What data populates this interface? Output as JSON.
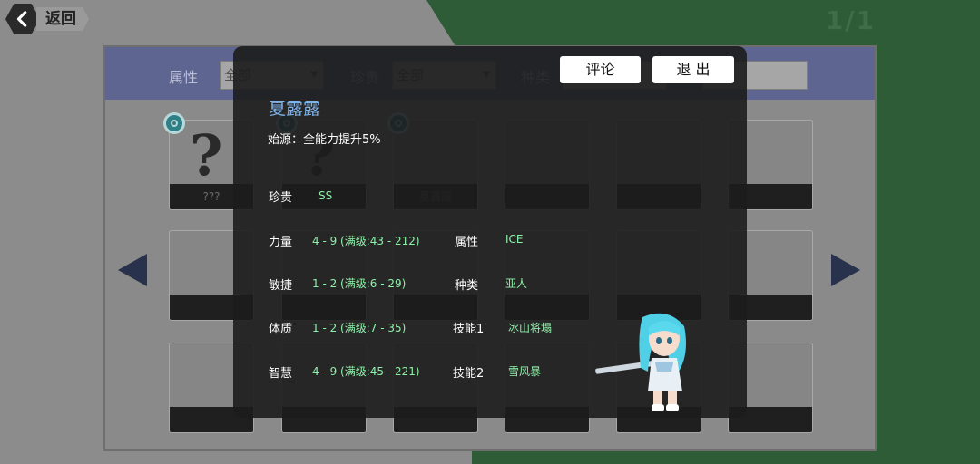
{
  "header": {
    "back_label": "返回",
    "page_counter": "1/1"
  },
  "filters": {
    "attribute_label": "属性",
    "attribute_value": "全部",
    "rarity_label": "珍贵",
    "rarity_value": "全部",
    "species_label": "种类",
    "species_value": ""
  },
  "grid": {
    "cards": [
      {
        "name": "???",
        "unknown": true,
        "badge": true
      },
      {
        "name": "???",
        "unknown": true,
        "badge": true
      },
      {
        "name": "夏露露",
        "unknown": false,
        "badge": true
      },
      {
        "name": ""
      },
      {
        "name": ""
      },
      {
        "name": ""
      },
      {
        "name": ""
      },
      {
        "name": ""
      },
      {
        "name": ""
      },
      {
        "name": ""
      },
      {
        "name": ""
      },
      {
        "name": ""
      },
      {
        "name": ""
      },
      {
        "name": ""
      },
      {
        "name": ""
      },
      {
        "name": ""
      },
      {
        "name": ""
      },
      {
        "name": ""
      }
    ]
  },
  "detail": {
    "comment_button": "评论",
    "exit_button": "退 出",
    "name": "夏露露",
    "origin": "始源：全能力提升5%",
    "rarity_label": "珍贵",
    "rarity_value": "SS",
    "stats": [
      {
        "label": "力量",
        "value": "4 - 9 (满级:43 - 212)"
      },
      {
        "label": "敏捷",
        "value": "1 - 2 (满级:6 - 29)"
      },
      {
        "label": "体质",
        "value": "1 - 2 (满级:7 - 35)"
      },
      {
        "label": "智慧",
        "value": "4 - 9 (满级:45 - 221)"
      }
    ],
    "info": [
      {
        "label": "属性",
        "value": "ICE"
      },
      {
        "label": "种类",
        "value": "亚人"
      },
      {
        "label": "技能1",
        "value": "冰山将塌"
      },
      {
        "label": "技能2",
        "value": "雪风暴"
      }
    ]
  },
  "colors": {
    "accent_name": "#7fb3ea",
    "value_green": "#8ff0a8",
    "filter_bar": "#5d6590",
    "right_bg": "#2d5c36"
  },
  "icons": [
    "chevron-left-icon",
    "triangle-left-icon",
    "triangle-right-icon",
    "ring-badge-icon"
  ]
}
